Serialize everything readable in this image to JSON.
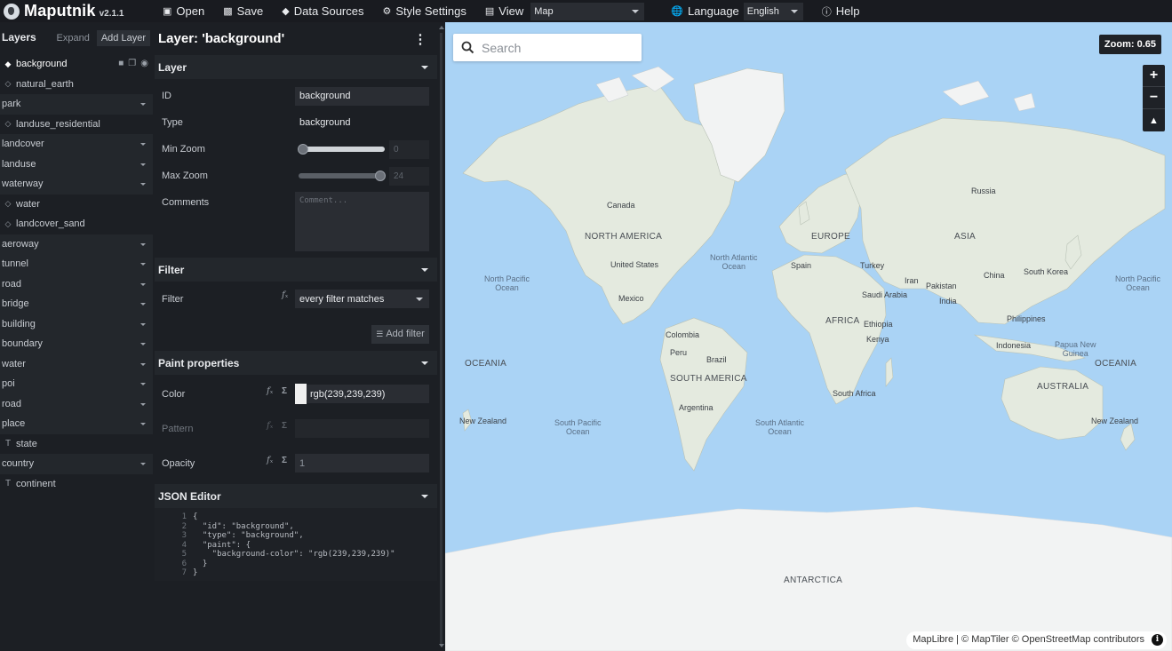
{
  "app": {
    "name": "Maputnik",
    "version": "v2.1.1"
  },
  "toolbar": {
    "open": "Open",
    "save": "Save",
    "data_sources": "Data Sources",
    "style_settings": "Style Settings",
    "view": "View",
    "view_select": "Map",
    "language": "Language",
    "language_select": "English",
    "help": "Help"
  },
  "layers_panel": {
    "title": "Layers",
    "expand": "Expand",
    "add_layer": "Add Layer",
    "items": [
      {
        "label": "background",
        "kind": "fill",
        "selected": true
      },
      {
        "label": "natural_earth",
        "kind": "raster"
      },
      {
        "label": "park",
        "kind": "group"
      },
      {
        "label": "landuse_residential",
        "kind": "raster"
      },
      {
        "label": "landcover",
        "kind": "group"
      },
      {
        "label": "landuse",
        "kind": "group"
      },
      {
        "label": "waterway",
        "kind": "group"
      },
      {
        "label": "water",
        "kind": "raster"
      },
      {
        "label": "landcover_sand",
        "kind": "raster"
      },
      {
        "label": "aeroway",
        "kind": "group"
      },
      {
        "label": "tunnel",
        "kind": "group"
      },
      {
        "label": "road",
        "kind": "group"
      },
      {
        "label": "bridge",
        "kind": "group"
      },
      {
        "label": "building",
        "kind": "group"
      },
      {
        "label": "boundary",
        "kind": "group"
      },
      {
        "label": "water",
        "kind": "group"
      },
      {
        "label": "poi",
        "kind": "group"
      },
      {
        "label": "road",
        "kind": "group"
      },
      {
        "label": "place",
        "kind": "group"
      },
      {
        "label": "state",
        "kind": "symbol"
      },
      {
        "label": "country",
        "kind": "group"
      },
      {
        "label": "continent",
        "kind": "symbol"
      }
    ]
  },
  "editor": {
    "title": "Layer: 'background'",
    "layer_section": {
      "title": "Layer",
      "id_label": "ID",
      "id_value": "background",
      "type_label": "Type",
      "type_value": "background",
      "min_zoom_label": "Min Zoom",
      "min_zoom_value": "0",
      "min_zoom_level": 0,
      "max_zoom_label": "Max Zoom",
      "max_zoom_value": "24",
      "max_zoom_level": 24,
      "comments_label": "Comments",
      "comments_placeholder": "Comment..."
    },
    "filter_section": {
      "title": "Filter",
      "filter_label": "Filter",
      "filter_select": "every filter matches",
      "add_filter": "Add filter"
    },
    "paint_section": {
      "title": "Paint properties",
      "color_label": "Color",
      "color_value": "rgb(239,239,239)",
      "color_swatch": "#efefef",
      "pattern_label": "Pattern",
      "opacity_label": "Opacity",
      "opacity_value": "1"
    },
    "json_section": {
      "title": "JSON Editor",
      "line_numbers": [
        "1",
        "2",
        "3",
        "4",
        "5",
        "6",
        "7"
      ],
      "lines": [
        "{",
        "  \"id\": \"background\",",
        "  \"type\": \"background\",",
        "  \"paint\": {",
        "    \"background-color\": \"rgb(239,239,239)\"",
        "  }",
        "}"
      ]
    }
  },
  "map": {
    "search_placeholder": "Search",
    "zoom_badge": "Zoom: 0.65",
    "attribution": "MapLibre | © MapTiler © OpenStreetMap contributors",
    "labels": {
      "canada": "Canada",
      "russia": "Russia",
      "north_america": "NORTH AMERICA",
      "europe": "EUROPE",
      "asia": "ASIA",
      "united_states": "United States",
      "north_atlantic": "North Atlantic\nOcean",
      "spain": "Spain",
      "turkey": "Turkey",
      "iran": "Iran",
      "pakistan": "Pakistan",
      "china": "China",
      "south_korea": "South Korea",
      "north_pacific_left": "North Pacific\nOcean",
      "north_pacific_right": "North Pacific\nOcean",
      "mexico": "Mexico",
      "saudi_arabia": "Saudi Arabia",
      "india": "India",
      "philippines": "Philippines",
      "africa": "AFRICA",
      "ethiopia": "Ethiopia",
      "colombia": "Colombia",
      "kenya": "Kenya",
      "indonesia": "Indonesia",
      "papua": "Papua New\nGuinea",
      "peru": "Peru",
      "brazil": "Brazil",
      "oceania_left": "OCEANIA",
      "oceania_right": "OCEANIA",
      "south_america": "SOUTH AMERICA",
      "australia": "AUSTRALIA",
      "argentina": "Argentina",
      "south_africa": "South Africa",
      "nz_left": "New Zealand",
      "nz_right": "New Zealand",
      "south_pacific": "South Pacific\nOcean",
      "south_atlantic": "South Atlantic\nOcean",
      "antarctica": "ANTARCTICA"
    }
  },
  "colors": {
    "toolbar_bg": "#191b20",
    "panel_bg": "#1c1f24",
    "ocean": "#aad3f5",
    "land": "#e4eadf",
    "ice": "#f2f3f3"
  }
}
